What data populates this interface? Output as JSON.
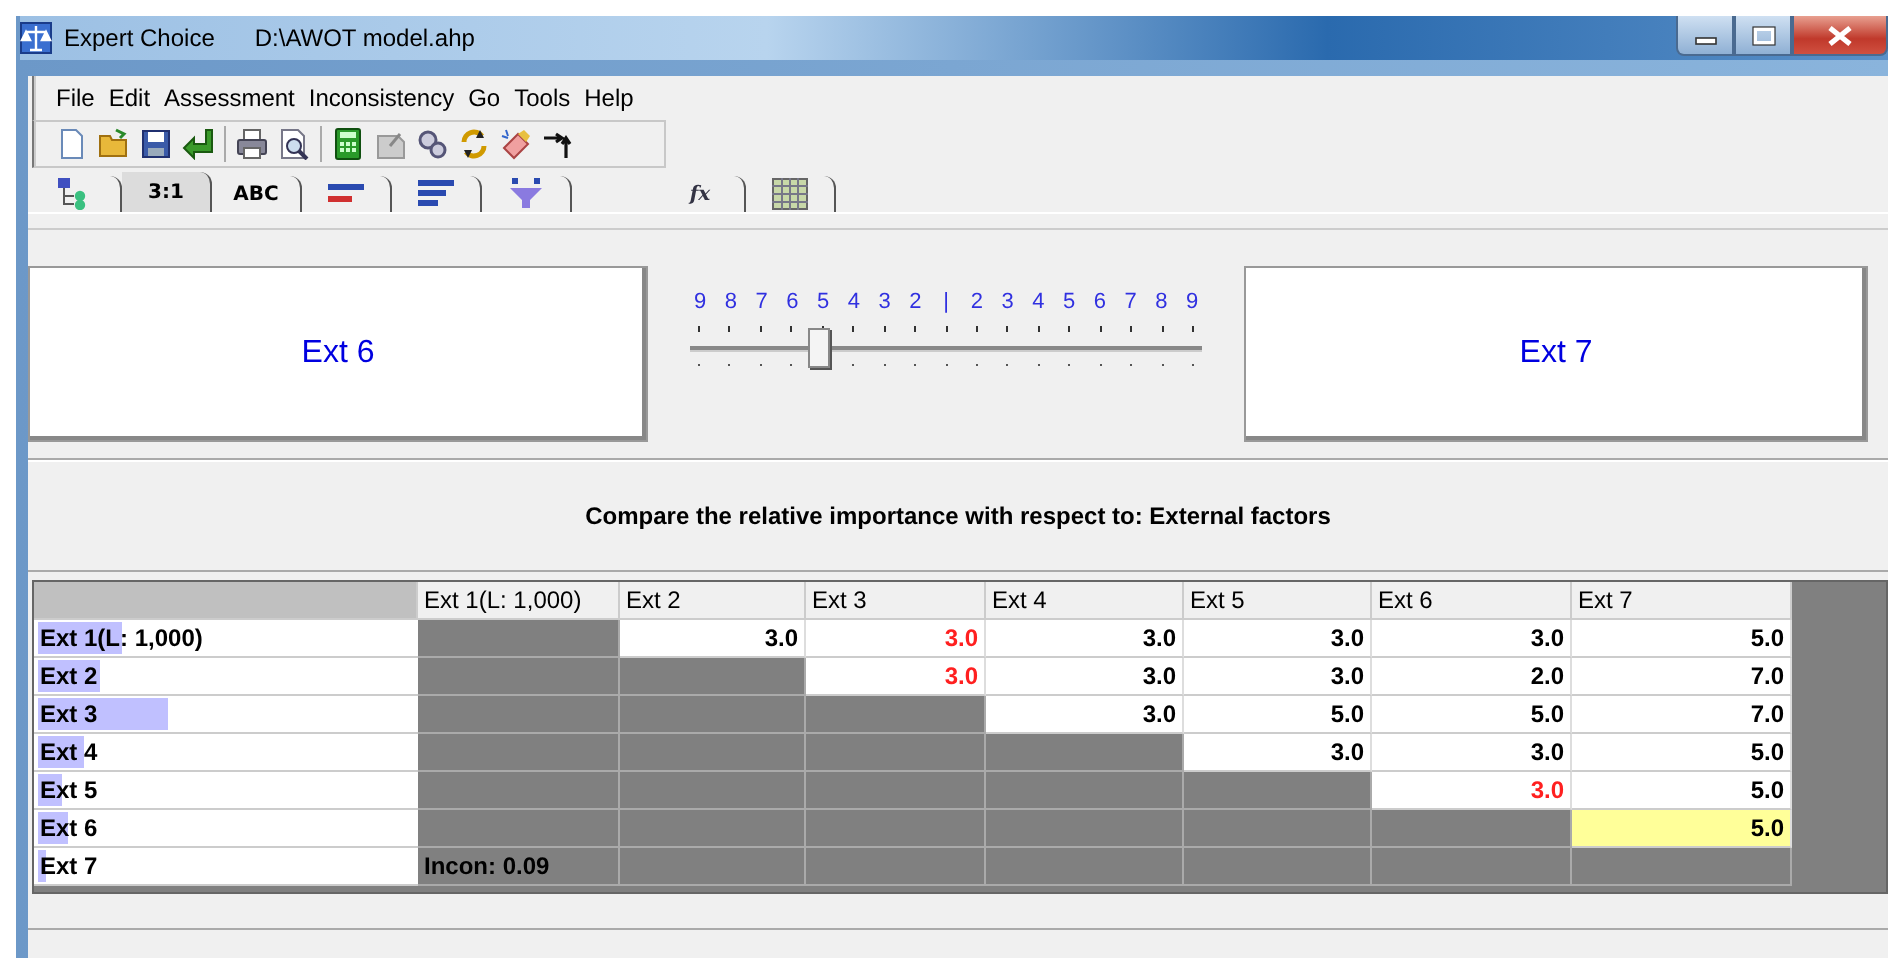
{
  "window": {
    "app": "Expert Choice",
    "file": "D:\\AWOT model.ahp"
  },
  "menu": [
    "File",
    "Edit",
    "Assessment",
    "Inconsistency",
    "Go",
    "Tools",
    "Help"
  ],
  "tabs": [
    {
      "kind": "icon",
      "selected": false
    },
    {
      "kind": "text",
      "label": "3:1",
      "selected": true
    },
    {
      "kind": "text",
      "label": "ABC",
      "selected": false
    },
    {
      "kind": "icon",
      "selected": false
    },
    {
      "kind": "icon",
      "selected": false
    },
    {
      "kind": "icon",
      "selected": false
    },
    {
      "kind": "text",
      "label": "fx",
      "selected": false
    },
    {
      "kind": "icon",
      "selected": false
    }
  ],
  "comparison": {
    "left": "Ext 6",
    "right": "Ext 7",
    "scale": [
      "9",
      "8",
      "7",
      "6",
      "5",
      "4",
      "3",
      "2",
      "|",
      "2",
      "3",
      "4",
      "5",
      "6",
      "7",
      "8",
      "9"
    ],
    "level": 0.25
  },
  "prompt": "Compare the relative importance with respect to: External factors",
  "matrix": {
    "columns": [
      "Ext 1(L: 1,000)",
      "Ext 2",
      "Ext 3",
      "Ext 4",
      "Ext 5",
      "Ext 6",
      "Ext 7"
    ],
    "rows": [
      {
        "label": "Ext 1(L: 1,000)",
        "level": 0.22,
        "cells": [
          {
            "kind": "blank"
          },
          {
            "kind": "value",
            "value": "3.0",
            "inverted": false,
            "selected": false
          },
          {
            "kind": "value",
            "value": "3.0",
            "inverted": true,
            "selected": false
          },
          {
            "kind": "value",
            "value": "3.0",
            "inverted": false,
            "selected": false
          },
          {
            "kind": "value",
            "value": "3.0",
            "inverted": false,
            "selected": false
          },
          {
            "kind": "value",
            "value": "3.0",
            "inverted": false,
            "selected": false
          },
          {
            "kind": "value",
            "value": "5.0",
            "inverted": false,
            "selected": false
          }
        ]
      },
      {
        "label": "Ext 2",
        "level": 0.16,
        "cells": [
          {
            "kind": "blank"
          },
          {
            "kind": "blank"
          },
          {
            "kind": "value",
            "value": "3.0",
            "inverted": true,
            "selected": false
          },
          {
            "kind": "value",
            "value": "3.0",
            "inverted": false,
            "selected": false
          },
          {
            "kind": "value",
            "value": "3.0",
            "inverted": false,
            "selected": false
          },
          {
            "kind": "value",
            "value": "2.0",
            "inverted": false,
            "selected": false
          },
          {
            "kind": "value",
            "value": "7.0",
            "inverted": false,
            "selected": false
          }
        ]
      },
      {
        "label": "Ext 3",
        "level": 0.34,
        "cells": [
          {
            "kind": "blank"
          },
          {
            "kind": "blank"
          },
          {
            "kind": "blank"
          },
          {
            "kind": "value",
            "value": "3.0",
            "inverted": false,
            "selected": false
          },
          {
            "kind": "value",
            "value": "5.0",
            "inverted": false,
            "selected": false
          },
          {
            "kind": "value",
            "value": "5.0",
            "inverted": false,
            "selected": false
          },
          {
            "kind": "value",
            "value": "7.0",
            "inverted": false,
            "selected": false
          }
        ]
      },
      {
        "label": "Ext 4",
        "level": 0.12,
        "cells": [
          {
            "kind": "blank"
          },
          {
            "kind": "blank"
          },
          {
            "kind": "blank"
          },
          {
            "kind": "blank"
          },
          {
            "kind": "value",
            "value": "3.0",
            "inverted": false,
            "selected": false
          },
          {
            "kind": "value",
            "value": "3.0",
            "inverted": false,
            "selected": false
          },
          {
            "kind": "value",
            "value": "5.0",
            "inverted": false,
            "selected": false
          }
        ]
      },
      {
        "label": "Ext 5",
        "level": 0.06,
        "cells": [
          {
            "kind": "blank"
          },
          {
            "kind": "blank"
          },
          {
            "kind": "blank"
          },
          {
            "kind": "blank"
          },
          {
            "kind": "blank"
          },
          {
            "kind": "value",
            "value": "3.0",
            "inverted": true,
            "selected": false
          },
          {
            "kind": "value",
            "value": "5.0",
            "inverted": false,
            "selected": false
          }
        ]
      },
      {
        "label": "Ext 6",
        "level": 0.08,
        "cells": [
          {
            "kind": "blank"
          },
          {
            "kind": "blank"
          },
          {
            "kind": "blank"
          },
          {
            "kind": "blank"
          },
          {
            "kind": "blank"
          },
          {
            "kind": "blank"
          },
          {
            "kind": "value",
            "value": "5.0",
            "inverted": false,
            "selected": true
          }
        ]
      },
      {
        "label": "Ext 7",
        "level": 0.02,
        "cells": [
          {
            "kind": "note",
            "text": "Incon: 0.09"
          },
          {
            "kind": "blank"
          },
          {
            "kind": "blank"
          },
          {
            "kind": "blank"
          },
          {
            "kind": "blank"
          },
          {
            "kind": "blank"
          },
          {
            "kind": "blank"
          }
        ]
      }
    ]
  }
}
